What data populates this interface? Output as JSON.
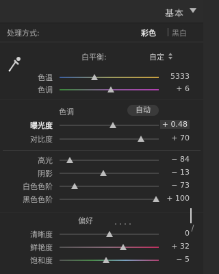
{
  "panel": {
    "title": "基本"
  },
  "treatment": {
    "label": "处理方式:",
    "color_option": "彩色",
    "bw_option": "黑白"
  },
  "white_balance": {
    "label": "白平衡:",
    "value": "自定",
    "sliders": [
      {
        "label": "色温",
        "value": "5333",
        "level": 0.35
      },
      {
        "label": "色调",
        "value": "+ 6",
        "level": 0.52
      }
    ]
  },
  "tone": {
    "label": "色调",
    "auto_label": "自动",
    "sliders": [
      {
        "label": "曝光度",
        "value": "+ 0.48",
        "level": 0.54
      },
      {
        "label": "对比度",
        "value": "+ 70",
        "level": 0.82
      }
    ],
    "sliders2": [
      {
        "label": "高光",
        "value": "− 84",
        "level": 0.1
      },
      {
        "label": "阴影",
        "value": "− 13",
        "level": 0.44
      },
      {
        "label": "白色色阶",
        "value": "− 73",
        "level": 0.15
      },
      {
        "label": "黑色色阶",
        "value": "+ 100",
        "level": 0.97
      }
    ]
  },
  "presence": {
    "label": "偏好",
    "sliders": [
      {
        "label": "清晰度",
        "value": "0",
        "level": 0.5
      },
      {
        "label": "鲜艳度",
        "value": "+ 32",
        "level": 0.64
      },
      {
        "label": "饱和度",
        "value": "− 5",
        "level": 0.47
      }
    ]
  }
}
